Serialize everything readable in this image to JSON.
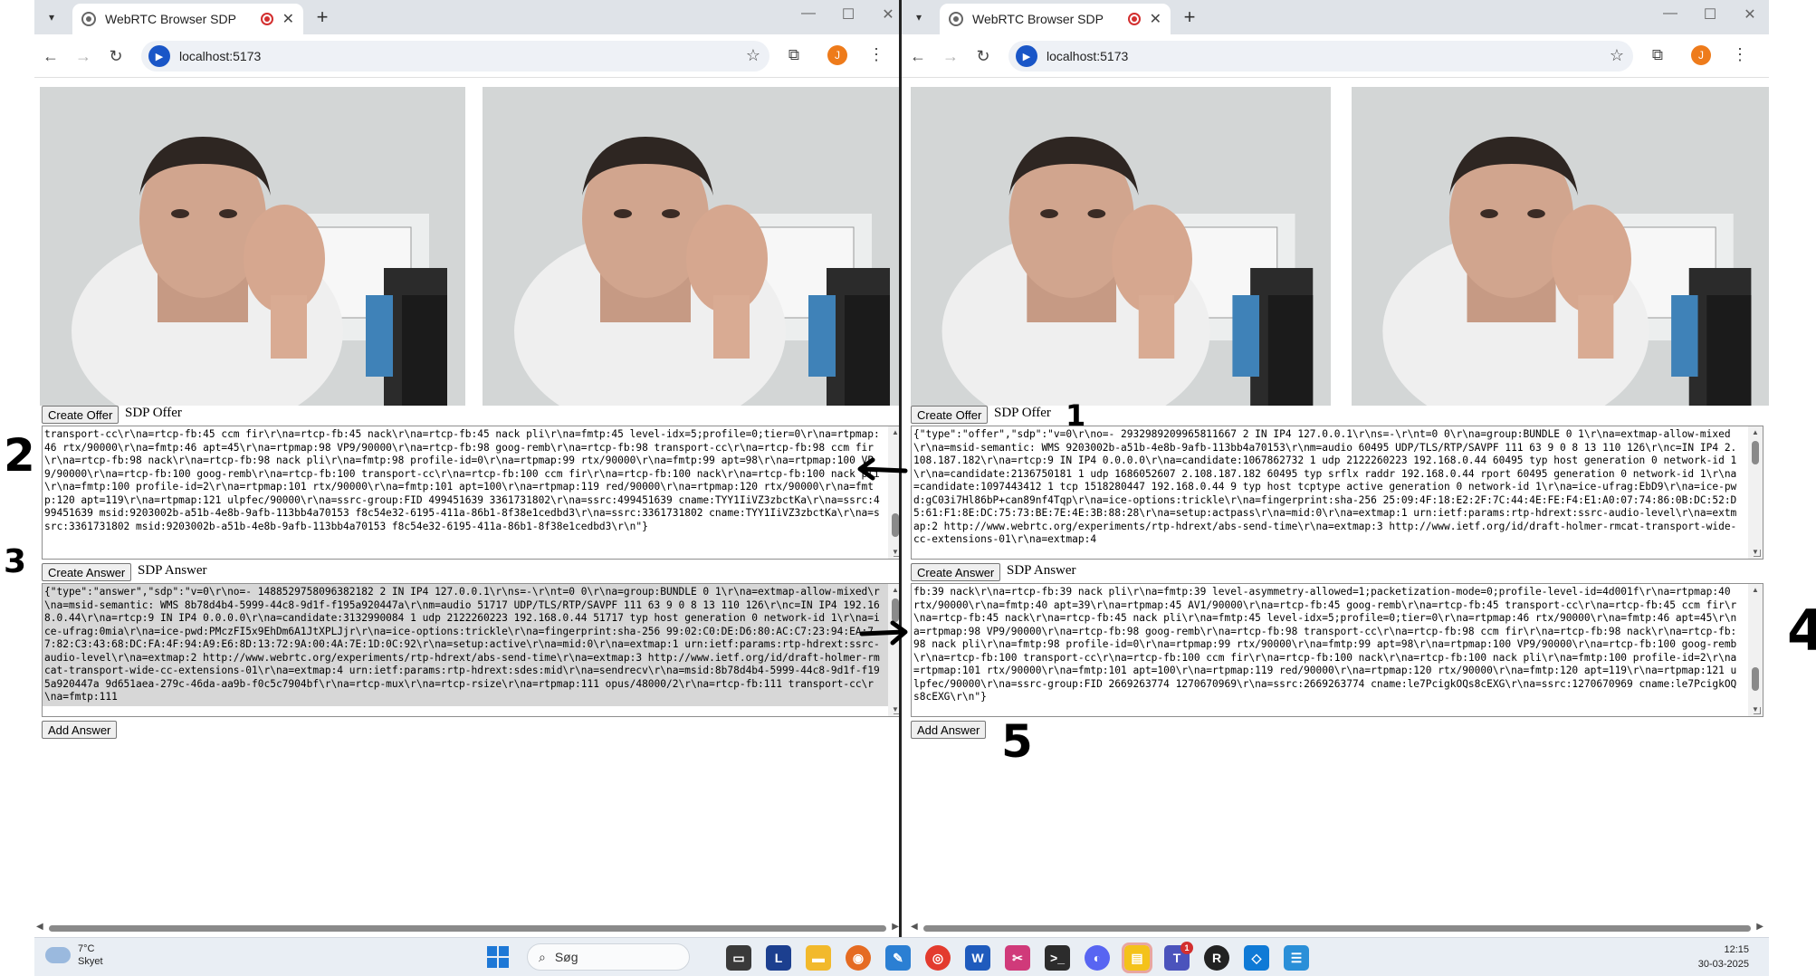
{
  "browser": {
    "tab_title": "WebRTC Browser SDP",
    "url": "localhost:5173",
    "profile_initial": "J"
  },
  "left": {
    "create_offer_label": "Create Offer",
    "sdp_offer_label": "SDP Offer",
    "offer_text": "transport-cc\\r\\na=rtcp-fb:45 ccm fir\\r\\na=rtcp-fb:45 nack\\r\\na=rtcp-fb:45 nack pli\\r\\na=fmtp:45 level-idx=5;profile=0;tier=0\\r\\na=rtpmap:46 rtx/90000\\r\\na=fmtp:46 apt=45\\r\\na=rtpmap:98 VP9/90000\\r\\na=rtcp-fb:98 goog-remb\\r\\na=rtcp-fb:98 transport-cc\\r\\na=rtcp-fb:98 ccm fir\\r\\na=rtcp-fb:98 nack\\r\\na=rtcp-fb:98 nack pli\\r\\na=fmtp:98 profile-id=0\\r\\na=rtpmap:99 rtx/90000\\r\\na=fmtp:99 apt=98\\r\\na=rtpmap:100 VP9/90000\\r\\na=rtcp-fb:100 goog-remb\\r\\na=rtcp-fb:100 transport-cc\\r\\na=rtcp-fb:100 ccm fir\\r\\na=rtcp-fb:100 nack\\r\\na=rtcp-fb:100 nack pli\\r\\na=fmtp:100 profile-id=2\\r\\na=rtpmap:101 rtx/90000\\r\\na=fmtp:101 apt=100\\r\\na=rtpmap:119 red/90000\\r\\na=rtpmap:120 rtx/90000\\r\\na=fmtp:120 apt=119\\r\\na=rtpmap:121 ulpfec/90000\\r\\na=ssrc-group:FID 499451639 3361731802\\r\\na=ssrc:499451639 cname:TYY1IiVZ3zbctKa\\r\\na=ssrc:499451639 msid:9203002b-a51b-4e8b-9afb-113bb4a70153 f8c54e32-6195-411a-86b1-8f38e1cedbd3\\r\\na=ssrc:3361731802 cname:TYY1IiVZ3zbctKa\\r\\na=ssrc:3361731802 msid:9203002b-a51b-4e8b-9afb-113bb4a70153 f8c54e32-6195-411a-86b1-8f38e1cedbd3\\r\\n\"}",
    "create_answer_label": "Create Answer",
    "sdp_answer_label": "SDP Answer",
    "answer_text": "{\"type\":\"answer\",\"sdp\":\"v=0\\r\\no=- 1488529758096382182 2 IN IP4 127.0.0.1\\r\\ns=-\\r\\nt=0 0\\r\\na=group:BUNDLE 0 1\\r\\na=extmap-allow-mixed\\r\\na=msid-semantic: WMS 8b78d4b4-5999-44c8-9d1f-f195a920447a\\r\\nm=audio 51717 UDP/TLS/RTP/SAVPF 111 63 9 0 8 13 110 126\\r\\nc=IN IP4 192.168.0.44\\r\\na=rtcp:9 IN IP4 0.0.0.0\\r\\na=candidate:3132990084 1 udp 2122260223 192.168.0.44 51717 typ host generation 0 network-id 1\\r\\na=ice-ufrag:0mia\\r\\na=ice-pwd:PMczFI5x9EhDm6A1JtXPLJjr\\r\\na=ice-options:trickle\\r\\na=fingerprint:sha-256 99:02:C0:DE:D6:80:AC:C7:23:94:EA:77:82:C3:43:68:DC:FA:4F:94:A9:E6:8D:13:72:9A:00:4A:7E:1D:0C:92\\r\\na=setup:active\\r\\na=mid:0\\r\\na=extmap:1 urn:ietf:params:rtp-hdrext:ssrc-audio-level\\r\\na=extmap:2 http://www.webrtc.org/experiments/rtp-hdrext/abs-send-time\\r\\na=extmap:3 http://www.ietf.org/id/draft-holmer-rmcat-transport-wide-cc-extensions-01\\r\\na=extmap:4 urn:ietf:params:rtp-hdrext:sdes:mid\\r\\na=sendrecv\\r\\na=msid:8b78d4b4-5999-44c8-9d1f-f195a920447a 9d651aea-279c-46da-aa9b-f0c5c7904bf\\r\\na=rtcp-mux\\r\\na=rtcp-rsize\\r\\na=rtpmap:111 opus/48000/2\\r\\na=rtcp-fb:111 transport-cc\\r\\na=fmtp:111",
    "add_answer_label": "Add Answer"
  },
  "right": {
    "create_offer_label": "Create Offer",
    "sdp_offer_label": "SDP Offer",
    "offer_text": "{\"type\":\"offer\",\"sdp\":\"v=0\\r\\no=- 2932989209965811667 2 IN IP4 127.0.0.1\\r\\ns=-\\r\\nt=0 0\\r\\na=group:BUNDLE 0 1\\r\\na=extmap-allow-mixed\\r\\na=msid-semantic: WMS 9203002b-a51b-4e8b-9afb-113bb4a70153\\r\\nm=audio 60495 UDP/TLS/RTP/SAVPF 111 63 9 0 8 13 110 126\\r\\nc=IN IP4 2.108.187.182\\r\\na=rtcp:9 IN IP4 0.0.0.0\\r\\na=candidate:1067862732 1 udp 2122260223 192.168.0.44 60495 typ host generation 0 network-id 1\\r\\na=candidate:2136750181 1 udp 1686052607 2.108.187.182 60495 typ srflx raddr 192.168.0.44 rport 60495 generation 0 network-id 1\\r\\na=candidate:1097443412 1 tcp 1518280447 192.168.0.44 9 typ host tcptype active generation 0 network-id 1\\r\\na=ice-ufrag:EbD9\\r\\na=ice-pwd:gC03i7Hl86bP+can89nf4Tqp\\r\\na=ice-options:trickle\\r\\na=fingerprint:sha-256 25:09:4F:18:E2:2F:7C:44:4E:FE:F4:E1:A0:07:74:86:0B:DC:52:D5:61:F1:8E:DC:75:73:BE:7E:4E:3B:88:28\\r\\na=setup:actpass\\r\\na=mid:0\\r\\na=extmap:1 urn:ietf:params:rtp-hdrext:ssrc-audio-level\\r\\na=extmap:2 http://www.webrtc.org/experiments/rtp-hdrext/abs-send-time\\r\\na=extmap:3 http://www.ietf.org/id/draft-holmer-rmcat-transport-wide-cc-extensions-01\\r\\na=extmap:4",
    "create_answer_label": "Create Answer",
    "sdp_answer_label": "SDP Answer",
    "answer_text": "fb:39 nack\\r\\na=rtcp-fb:39 nack pli\\r\\na=fmtp:39 level-asymmetry-allowed=1;packetization-mode=0;profile-level-id=4d001f\\r\\na=rtpmap:40 rtx/90000\\r\\na=fmtp:40 apt=39\\r\\na=rtpmap:45 AV1/90000\\r\\na=rtcp-fb:45 goog-remb\\r\\na=rtcp-fb:45 transport-cc\\r\\na=rtcp-fb:45 ccm fir\\r\\na=rtcp-fb:45 nack\\r\\na=rtcp-fb:45 nack pli\\r\\na=fmtp:45 level-idx=5;profile=0;tier=0\\r\\na=rtpmap:46 rtx/90000\\r\\na=fmtp:46 apt=45\\r\\na=rtpmap:98 VP9/90000\\r\\na=rtcp-fb:98 goog-remb\\r\\na=rtcp-fb:98 transport-cc\\r\\na=rtcp-fb:98 ccm fir\\r\\na=rtcp-fb:98 nack\\r\\na=rtcp-fb:98 nack pli\\r\\na=fmtp:98 profile-id=0\\r\\na=rtpmap:99 rtx/90000\\r\\na=fmtp:99 apt=98\\r\\na=rtpmap:100 VP9/90000\\r\\na=rtcp-fb:100 goog-remb\\r\\na=rtcp-fb:100 transport-cc\\r\\na=rtcp-fb:100 ccm fir\\r\\na=rtcp-fb:100 nack\\r\\na=rtcp-fb:100 nack pli\\r\\na=fmtp:100 profile-id=2\\r\\na=rtpmap:101 rtx/90000\\r\\na=fmtp:101 apt=100\\r\\na=rtpmap:119 red/90000\\r\\na=rtpmap:120 rtx/90000\\r\\na=fmtp:120 apt=119\\r\\na=rtpmap:121 ulpfec/90000\\r\\na=ssrc-group:FID 2669263774 1270670969\\r\\na=ssrc:2669263774 cname:le7PcigkOQs8cEXG\\r\\na=ssrc:1270670969 cname:le7PcigkOQs8cEXG\\r\\n\"}",
    "add_answer_label": "Add Answer"
  },
  "annotations": {
    "n1": "1",
    "n2": "2",
    "n3": "3",
    "n4": "4",
    "n5": "5"
  },
  "taskbar": {
    "temperature": "7°C",
    "weather_text": "Skyet",
    "search_placeholder": "Søg",
    "teams_badge": "1",
    "time": "12:15",
    "date": "30-03-2025"
  },
  "colors": {
    "taskbar_bg": "#e9eef4",
    "tab_strip_bg": "#dfe3e8",
    "recording_red": "#d32f2f",
    "site_icon_blue": "#1a56c7",
    "profile_orange": "#ee7b1b"
  },
  "icons": {
    "weather": "cloud-icon",
    "start": "windows-start-icon",
    "search": "magnifier-icon"
  }
}
